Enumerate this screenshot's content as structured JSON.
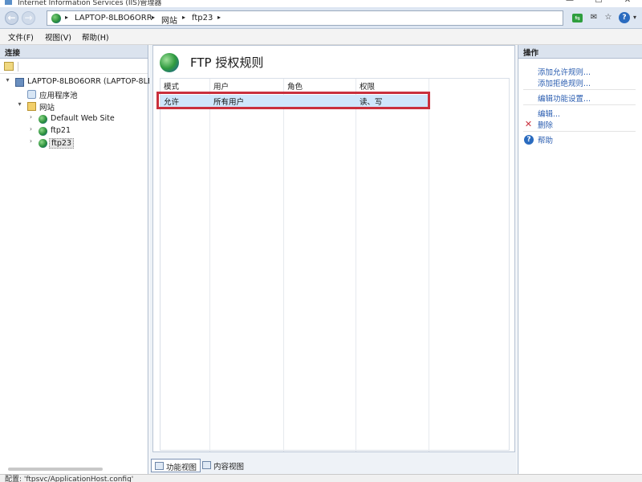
{
  "window": {
    "title": "Internet Information Services (IIS)管理器",
    "controls": {
      "minimize": "—",
      "maximize": "☐",
      "close": "✕"
    }
  },
  "addressbar": {
    "back": "←",
    "forward": "→",
    "crumbs": [
      "LAPTOP-8LBO6ORR",
      "网站",
      "ftp23"
    ],
    "separator": "▸",
    "dropdown": "▾",
    "tools": [
      "⇆",
      "✉",
      "☆",
      "?"
    ]
  },
  "menu": [
    "文件(F)",
    "视图(V)",
    "帮助(H)"
  ],
  "connections": {
    "header": "连接",
    "tree": [
      {
        "label": "LAPTOP-8LBO6ORR (LAPTOP-8LB",
        "expander": "▾",
        "icon": "server-icon"
      },
      {
        "label": "应用程序池",
        "expander": "",
        "icon": "app-pool-icon"
      },
      {
        "label": "网站",
        "expander": "▾",
        "icon": "folder-icon"
      },
      {
        "label": "Default Web Site",
        "expander": "›",
        "icon": "website-icon"
      },
      {
        "label": "ftp21",
        "expander": "›",
        "icon": "website-icon"
      },
      {
        "label": "ftp23",
        "expander": "›",
        "icon": "website-icon"
      }
    ]
  },
  "feature": {
    "title": "FTP 授权规则",
    "columns": [
      "模式",
      "用户",
      "角色",
      "权限"
    ],
    "rows": [
      {
        "mode": "允许",
        "user": "所有用户",
        "role": "",
        "perm": "读、写"
      }
    ]
  },
  "views": {
    "features": "功能视图",
    "content": "内容视图"
  },
  "actions": {
    "header": "操作",
    "items": [
      {
        "label": "添加允许规则...",
        "icon": ""
      },
      {
        "label": "添加拒绝规则...",
        "icon": ""
      },
      {
        "label": "编辑功能设置...",
        "icon": ""
      },
      {
        "label": "编辑...",
        "icon": ""
      },
      {
        "label": "删除",
        "icon": "delete-icon",
        "glyph": "✕",
        "color": "#c9303d"
      },
      {
        "label": "帮助",
        "icon": "help-icon",
        "glyph": "?",
        "color": "#2a6bbf"
      }
    ]
  },
  "statusbar": {
    "text": "配置: 'ftpsvc/ApplicationHost.config'"
  }
}
